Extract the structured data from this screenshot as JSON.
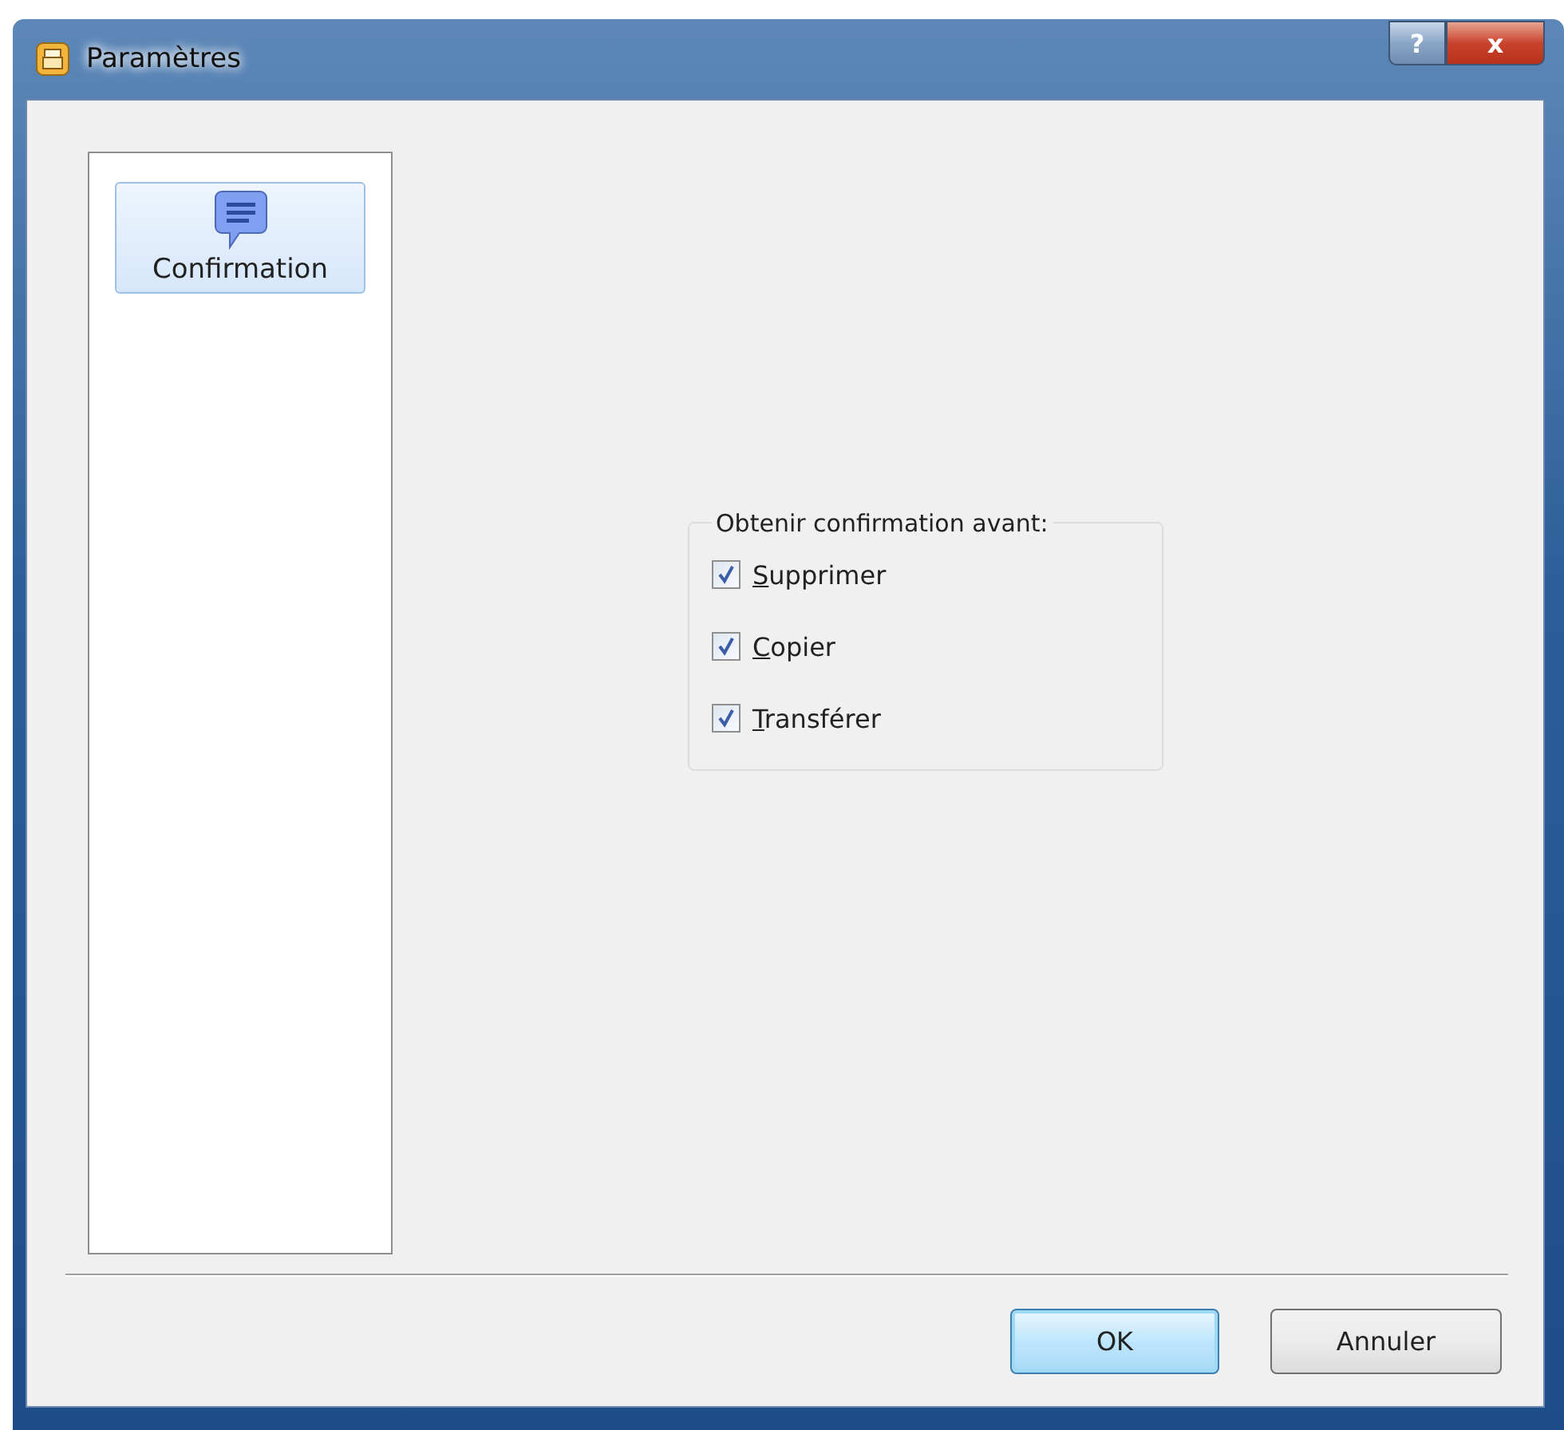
{
  "window": {
    "title": "Paramètres",
    "help_button": "?",
    "close_button": "x"
  },
  "sidebar": {
    "items": [
      {
        "label": "Confirmation",
        "selected": true
      }
    ]
  },
  "group": {
    "legend": "Obtenir confirmation avant:",
    "options": [
      {
        "label": "Supprimer",
        "first_letter_underlined": true,
        "checked": true
      },
      {
        "label": "Copier",
        "first_letter_underlined": true,
        "checked": true
      },
      {
        "label": "Transférer",
        "first_letter_underlined": true,
        "checked": true
      }
    ]
  },
  "buttons": [
    {
      "label": "OK",
      "default": true
    },
    {
      "label": "Annuler",
      "default": false
    }
  ]
}
